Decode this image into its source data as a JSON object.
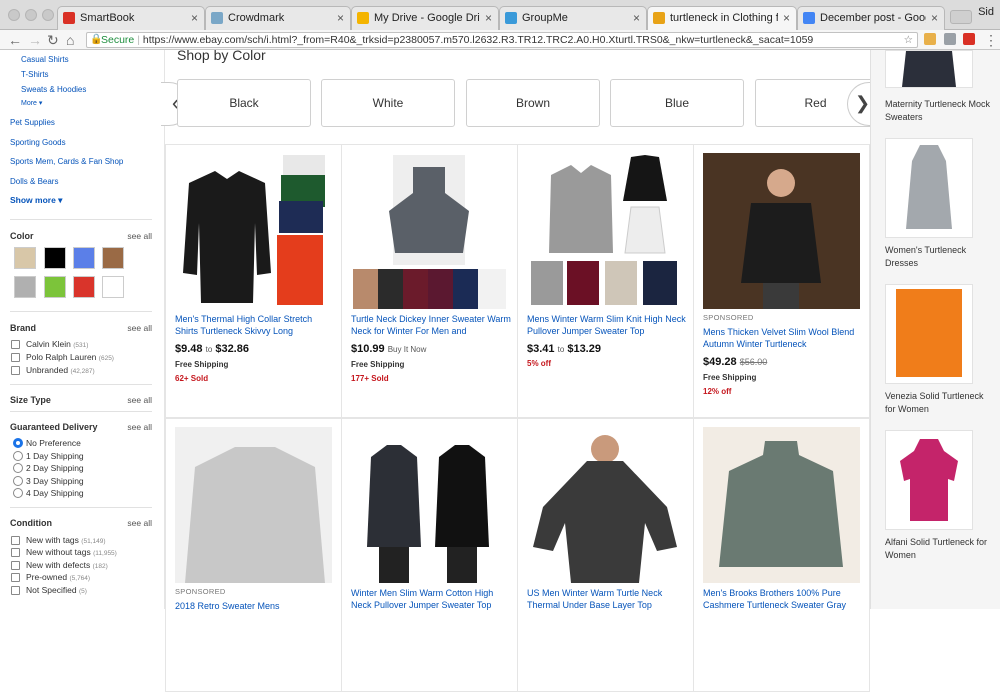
{
  "browser": {
    "tabs": [
      {
        "title": "SmartBook",
        "fav": "#d93025"
      },
      {
        "title": "Crowdmark",
        "fav": "#7aa7c7"
      },
      {
        "title": "My Drive - Google Drive",
        "fav": "#f4b400"
      },
      {
        "title": "GroupMe",
        "fav": "#3a9ad9"
      },
      {
        "title": "turtleneck in Clothing for Me",
        "fav": "#e8a317"
      },
      {
        "title": "December post - Google Do",
        "fav": "#4285f4"
      }
    ],
    "close_glyph": "×",
    "profile": "Sid",
    "secure_label": "Secure",
    "url": "https://www.ebay.com/sch/i.html?_from=R40&_trksid=p2380057.m570.l2632.R3.TR12.TRC2.A0.H0.Xturtl.TRS0&_nkw=turtleneck&_sacat=1059"
  },
  "sidebar": {
    "categories": [
      "Casual Shirts",
      "T-Shirts",
      "Sweats & Hoodies"
    ],
    "more_label": "More ▾",
    "other_categories": [
      "Pet Supplies",
      "Sporting Goods",
      "Sports Mem, Cards & Fan Shop",
      "Dolls & Bears"
    ],
    "show_more_label": "Show more ▾",
    "see_all": "see all",
    "color_heading": "Color",
    "colors": [
      "#d8c7a8",
      "#000000",
      "#5b7fe8",
      "#9a6a45",
      "#b0b0b0",
      "#7cc43a",
      "#d9342b",
      "#ffffff"
    ],
    "brand_heading": "Brand",
    "brands": [
      {
        "label": "Calvin Klein",
        "count": "(531)"
      },
      {
        "label": "Polo Ralph Lauren",
        "count": "(625)"
      },
      {
        "label": "Unbranded",
        "count": "(42,287)"
      }
    ],
    "size_heading": "Size Type",
    "delivery_heading": "Guaranteed Delivery",
    "delivery_options": [
      "No Preference",
      "1 Day Shipping",
      "2 Day Shipping",
      "3 Day Shipping",
      "4 Day Shipping"
    ],
    "condition_heading": "Condition",
    "conditions": [
      {
        "label": "New with tags",
        "count": "(51,149)"
      },
      {
        "label": "New without tags",
        "count": "(11,955)"
      },
      {
        "label": "New with defects",
        "count": "(182)"
      },
      {
        "label": "Pre-owned",
        "count": "(5,764)"
      },
      {
        "label": "Not Specified",
        "count": "(5)"
      }
    ]
  },
  "main": {
    "shop_by_color": "Shop by Color",
    "color_buttons": [
      "Black",
      "White",
      "Brown",
      "Blue",
      "Red"
    ],
    "cards": [
      {
        "title": "Men's Thermal High Collar Stretch Shirts Turtleneck Skivvy Long",
        "price": "$9.48",
        "to": "to",
        "price2": "$32.86",
        "ship": "Free Shipping",
        "sold": "62+ Sold",
        "color": "#1a1a1a"
      },
      {
        "title": "Turtle Neck Dickey Inner Sweater Warm Neck for Winter For Men and",
        "price": "$10.99",
        "buy": "Buy It Now",
        "ship": "Free Shipping",
        "sold": "177+ Sold",
        "color": "#5a6068"
      },
      {
        "title": "Mens Winter Warm Slim Knit High Neck Pullover Jumper Sweater Top",
        "price": "$3.41",
        "to": "to",
        "price2": "$13.29",
        "sold": "5% off",
        "color": "#9a9a9a"
      },
      {
        "sponsored": "SPONSORED",
        "title": "Mens Thicken Velvet Slim Wool Blend Autumn Winter Turtleneck",
        "price": "$49.28",
        "was": "$56.00",
        "ship": "Free Shipping",
        "sold": "12% off",
        "color": "#222222"
      },
      {
        "sponsored": "SPONSORED",
        "title": "2018 Retro Sweater Mens",
        "color": "#c8c8c8"
      },
      {
        "title": "Winter Men Slim Warm Cotton High Neck Pullover Jumper Sweater Top",
        "color": "#2c2f36"
      },
      {
        "title": "US Men Winter Warm Turtle Neck Thermal Under Base Layer Top",
        "color": "#3a3a3a"
      },
      {
        "title": "Men's Brooks Brothers 100% Pure Cashmere Turtleneck Sweater Gray",
        "color": "#6a7a72"
      }
    ]
  },
  "rail": {
    "items": [
      {
        "title": "Maternity Turtleneck Mock Sweaters",
        "color": "#2b2f3a"
      },
      {
        "title": "Women's Turtleneck Dresses",
        "color": "#a3a8ad"
      },
      {
        "title": "Venezia Solid Turtleneck for Women",
        "color": "#f07d1a"
      },
      {
        "title": "Alfani Solid Turtleneck for Women",
        "color": "#c4246a"
      }
    ]
  }
}
